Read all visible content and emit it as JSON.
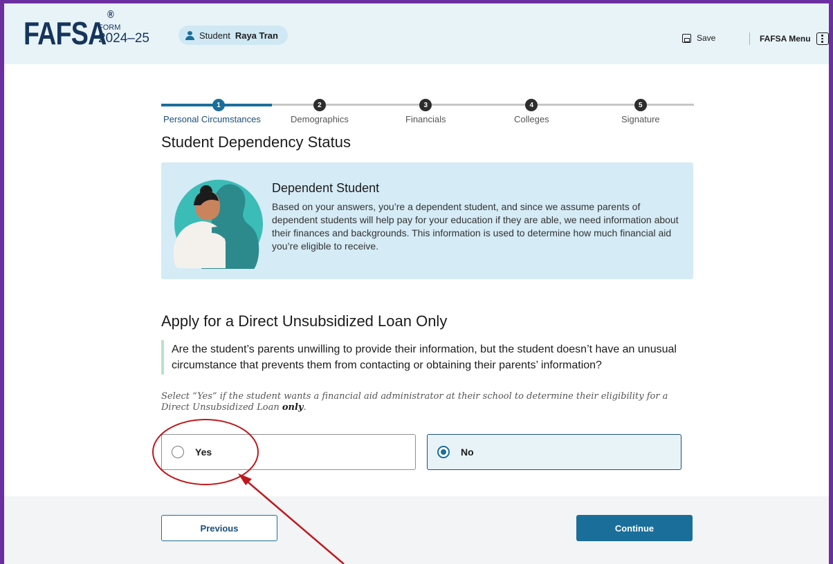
{
  "header": {
    "logo": "FAFSA",
    "logo_mark": "®",
    "form_label": "FORM",
    "form_year": "2024–25",
    "student_prefix": "Student",
    "student_name": "Raya Tran",
    "save_label": "Save",
    "menu_label": "FAFSA Menu"
  },
  "stepper": {
    "steps": [
      {
        "num": "1",
        "label": "Personal Circumstances"
      },
      {
        "num": "2",
        "label": "Demographics"
      },
      {
        "num": "3",
        "label": "Financials"
      },
      {
        "num": "4",
        "label": "Colleges"
      },
      {
        "num": "5",
        "label": "Signature"
      }
    ],
    "active_step": 1
  },
  "main": {
    "section_title": "Student Dependency Status",
    "info_title": "Dependent Student",
    "info_text": "Based on your answers, you’re a dependent student, and since we assume parents of dependent students will help pay for your education if they are able, we need information about their finances and backgrounds. This information is used to determine how much financial aid you’re eligible to receive.",
    "question_title": "Apply for a Direct Unsubsidized Loan Only",
    "question_text": "Are the student’s parents unwilling to provide their information, but the student doesn’t have an unusual circumstance that prevents them from contacting or obtaining their parents’ information?",
    "hint_text": "Select “Yes” if the student wants a financial aid administrator at their school to determine their eligibility for a Direct Unsubsidized Loan",
    "hint_emphasis": "only",
    "hint_end": ".",
    "options": [
      {
        "label": "Yes",
        "selected": false
      },
      {
        "label": "No",
        "selected": true
      }
    ]
  },
  "footer": {
    "previous_label": "Previous",
    "continue_label": "Continue"
  },
  "colors": {
    "accent": "#1a6e9a",
    "frame": "#6b2fa0",
    "annotation": "#c0171c"
  }
}
